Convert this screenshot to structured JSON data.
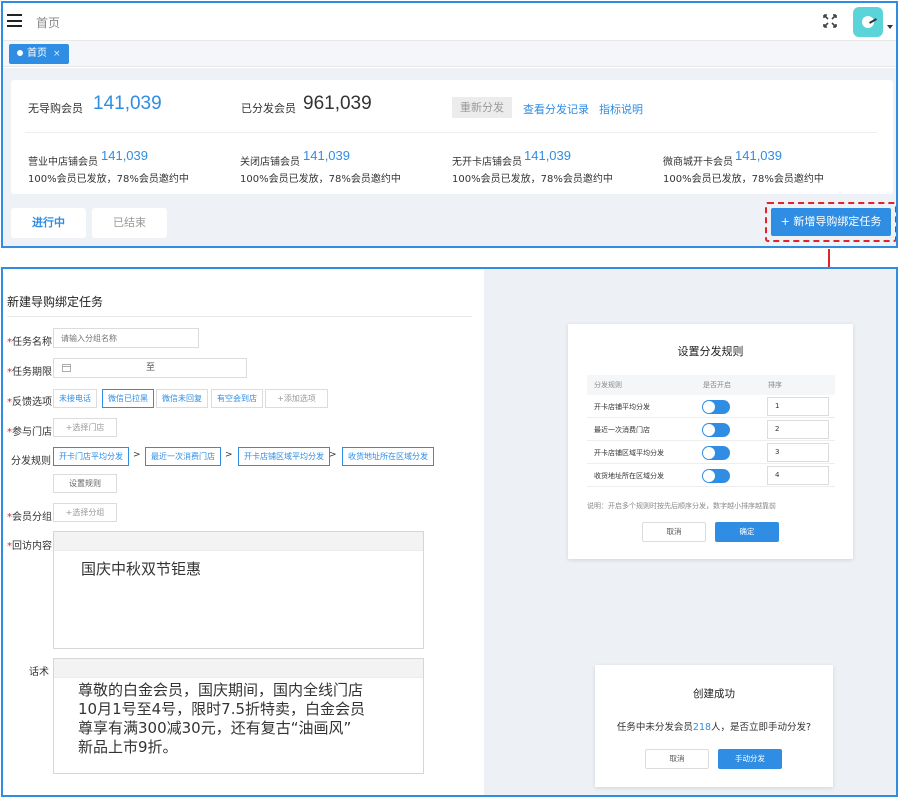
{
  "topbar": {
    "breadcrumb": "首页",
    "tab_label": "首页",
    "tab_close": "×"
  },
  "stats": {
    "no_guide_label": "无导购会员",
    "no_guide_value": "141,039",
    "assigned_label": "已分发会员",
    "assigned_value": "961,039",
    "redistribute_label": "重新分发",
    "view_records_label": "查看分发记录",
    "metric_desc_label": "指标说明",
    "sub_stats": [
      {
        "label": "营业中店铺会员",
        "value": "141,039",
        "desc": "100%会员已发放，78%会员邀约中"
      },
      {
        "label": "关闭店铺会员",
        "value": "141,039",
        "desc": "100%会员已发放，78%会员邀约中"
      },
      {
        "label": "无开卡店铺会员",
        "value": "141,039",
        "desc": "100%会员已发放，78%会员邀约中"
      },
      {
        "label": "微商城开卡会员",
        "value": "141,039",
        "desc": "100%会员已发放，78%会员邀约中"
      }
    ]
  },
  "filters": {
    "in_progress_label": "进行中",
    "ended_label": "已结束",
    "new_task_label": "+ 新增导购绑定任务"
  },
  "form": {
    "title": "新建导购绑定任务",
    "task_name_label": "任务名称",
    "task_name_placeholder": "请输入分组名称",
    "period_label": "任务期限",
    "period_sep": "至",
    "feedback_label": "反馈选项",
    "feedback_options": [
      "未接电话",
      "微信已拉黑",
      "微信未回复",
      "有空会到店"
    ],
    "add_option_label": "+添加选项",
    "store_label": "参与门店",
    "select_store_label": "+选择门店",
    "rule_label": "分发规则",
    "rule_steps": [
      "开卡门店平均分发",
      "最近一次消费门店",
      "开卡店铺区域平均分发",
      "收货地址所在区域分发"
    ],
    "rule_sep": ">",
    "set_rule_label": "设置规则",
    "group_label": "会员分组",
    "select_group_label": "+选择分组",
    "visit_content_label": "回访内容",
    "visit_content_text": "国庆中秋双节钜惠",
    "script_label": "话术",
    "script_text": [
      "尊敬的白金会员，国庆期间，国内全线门店",
      "10月1号至4号，限时7.5折特卖，白金会员",
      "尊享有满300减30元，还有复古“油画风”",
      "新品上市9折。"
    ]
  },
  "rule_modal": {
    "title": "设置分发规则",
    "col_rule": "分发规则",
    "col_enabled": "是否开启",
    "col_order": "排序",
    "rows": [
      {
        "name": "开卡店铺平均分发",
        "order": "1"
      },
      {
        "name": "最近一次消费门店",
        "order": "2"
      },
      {
        "name": "开卡店铺区域平均分发",
        "order": "3"
      },
      {
        "name": "收货地址所在区域分发",
        "order": "4"
      }
    ],
    "note": "说明：开启多个规则时按先后顺序分发，数字越小排序越靠前",
    "cancel_label": "取消",
    "confirm_label": "确定"
  },
  "success_modal": {
    "title": "创建成功",
    "text_before": "任务中未分发会员",
    "count": "218",
    "text_after": "人，是否立即手动分发?",
    "cancel_label": "取消",
    "manual_label": "手动分发"
  },
  "colors": {
    "accent": "#2f8de4",
    "highlight_red": "#e0242a"
  }
}
